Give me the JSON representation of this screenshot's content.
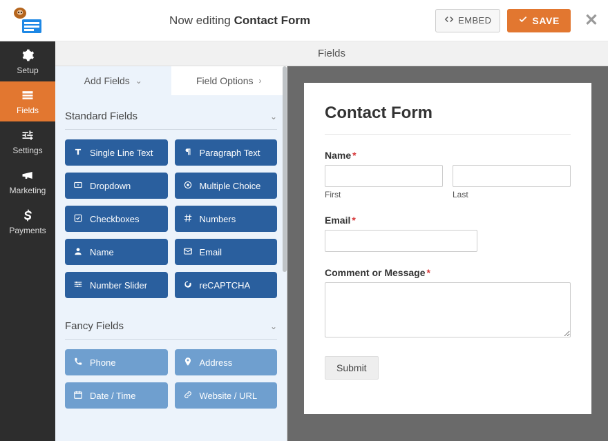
{
  "header": {
    "now_editing_prefix": "Now editing ",
    "form_name": "Contact Form",
    "embed_label": "EMBED",
    "save_label": "SAVE"
  },
  "rail": {
    "items": [
      {
        "id": "setup",
        "label": "Setup"
      },
      {
        "id": "fields",
        "label": "Fields",
        "active": true
      },
      {
        "id": "settings",
        "label": "Settings"
      },
      {
        "id": "marketing",
        "label": "Marketing"
      },
      {
        "id": "payments",
        "label": "Payments"
      }
    ]
  },
  "panel": {
    "title": "Fields",
    "tabs": {
      "add_fields": "Add Fields",
      "field_options": "Field Options"
    },
    "sections": [
      {
        "title": "Standard Fields",
        "style": "standard",
        "fields": [
          {
            "id": "text",
            "label": "Single Line Text"
          },
          {
            "id": "para",
            "label": "Paragraph Text"
          },
          {
            "id": "dropdown",
            "label": "Dropdown"
          },
          {
            "id": "multi",
            "label": "Multiple Choice"
          },
          {
            "id": "checkboxes",
            "label": "Checkboxes"
          },
          {
            "id": "numbers",
            "label": "Numbers"
          },
          {
            "id": "name",
            "label": "Name"
          },
          {
            "id": "email",
            "label": "Email"
          },
          {
            "id": "slider",
            "label": "Number Slider"
          },
          {
            "id": "recaptcha",
            "label": "reCAPTCHA"
          }
        ]
      },
      {
        "title": "Fancy Fields",
        "style": "fancy",
        "fields": [
          {
            "id": "phone",
            "label": "Phone"
          },
          {
            "id": "address",
            "label": "Address"
          },
          {
            "id": "date",
            "label": "Date / Time"
          },
          {
            "id": "url",
            "label": "Website / URL"
          }
        ]
      }
    ]
  },
  "form": {
    "title": "Contact Form",
    "name_label": "Name",
    "first_sublabel": "First",
    "last_sublabel": "Last",
    "email_label": "Email",
    "comment_label": "Comment or Message",
    "submit_label": "Submit",
    "required_marker": "*"
  },
  "colors": {
    "accent_orange": "#e27730",
    "field_blue": "#2a5f9e",
    "fancy_blue": "#6f9fcf"
  }
}
